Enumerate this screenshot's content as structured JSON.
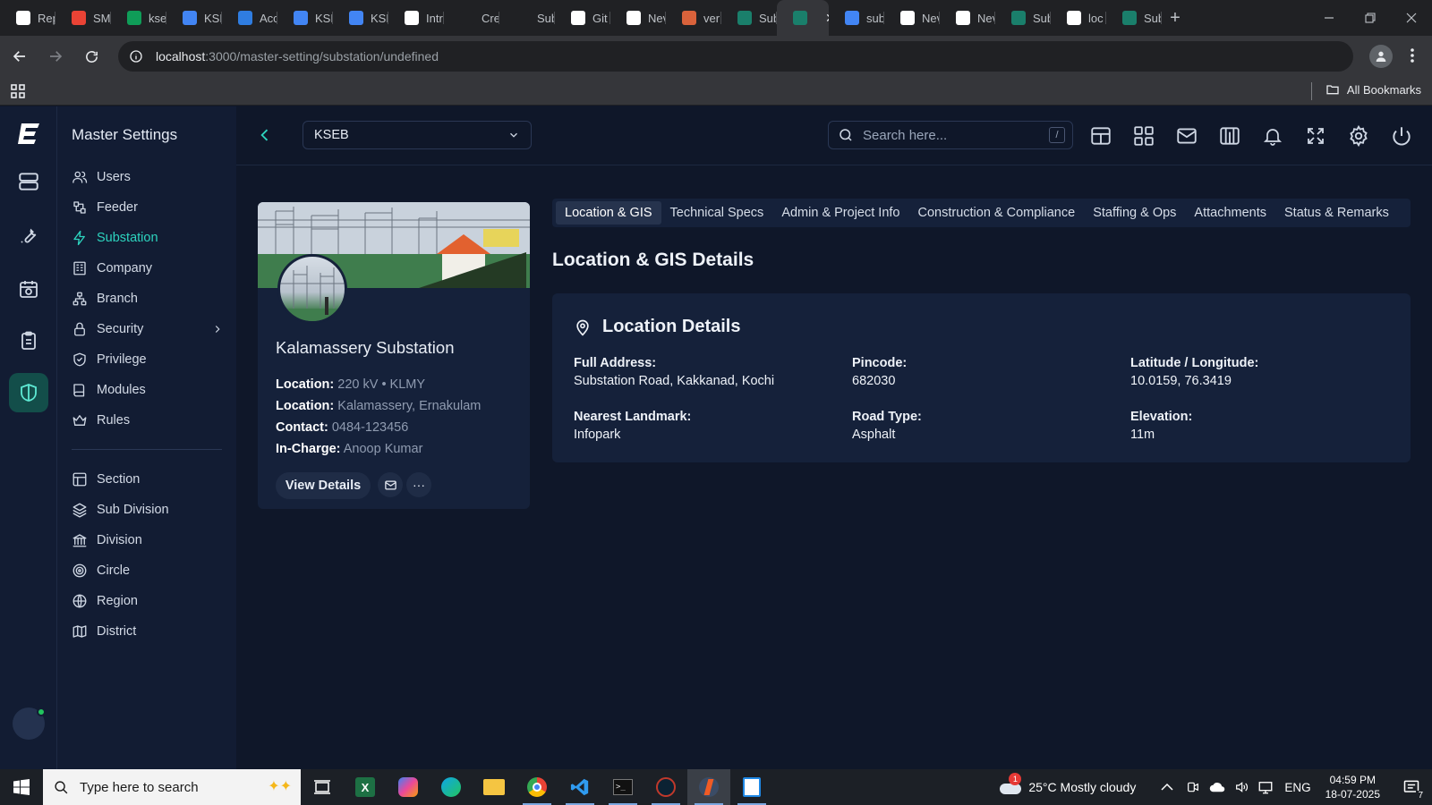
{
  "browser": {
    "tabs": [
      {
        "title": "Rep",
        "favicon": "report-icon",
        "color": "#ffffff"
      },
      {
        "title": "SM",
        "favicon": "gmail-icon",
        "color": "#ea4335"
      },
      {
        "title": "ksel",
        "favicon": "sheets-icon",
        "color": "#0f9d58"
      },
      {
        "title": "KSE",
        "favicon": "docs-icon",
        "color": "#4285f4"
      },
      {
        "title": "Acc",
        "favicon": "azure-icon",
        "color": "#2f7de1"
      },
      {
        "title": "KSE",
        "favicon": "docs-icon",
        "color": "#4285f4"
      },
      {
        "title": "KSE",
        "favicon": "docs-icon",
        "color": "#4285f4"
      },
      {
        "title": "Intr",
        "favicon": "openai-icon",
        "color": "#ffffff"
      },
      {
        "title": "Cre",
        "favicon": "blank-icon",
        "color": "#202124"
      },
      {
        "title": "Sub",
        "favicon": "blank-icon",
        "color": "#202124"
      },
      {
        "title": "Git",
        "favicon": "github-icon",
        "color": "#ffffff"
      },
      {
        "title": "Nev",
        "favicon": "chatgpt-icon",
        "color": "#ffffff"
      },
      {
        "title": "ver",
        "favicon": "vercel-icon",
        "color": "#d9623b"
      },
      {
        "title": "Sub",
        "favicon": "app-e-icon",
        "color": "#1a7f6b"
      },
      {
        "title": "",
        "favicon": "app-e-icon",
        "color": "#1a7f6b",
        "active": true,
        "close": "✕"
      },
      {
        "title": "sub",
        "favicon": "google-icon",
        "color": "#4285f4"
      },
      {
        "title": "Nev",
        "favicon": "chatgpt-icon",
        "color": "#ffffff"
      },
      {
        "title": "Nev",
        "favicon": "chatgpt-icon",
        "color": "#ffffff"
      },
      {
        "title": "Sub",
        "favicon": "app-e-icon",
        "color": "#1a7f6b"
      },
      {
        "title": "loc",
        "favicon": "vercel-triangle-icon",
        "color": "#ffffff"
      },
      {
        "title": "Sub",
        "favicon": "app-e-icon",
        "color": "#1a7f6b"
      }
    ],
    "new_tab": "+",
    "url_host": "localhost",
    "url_path": ":3000/master-setting/substation/undefined",
    "all_bookmarks": "All Bookmarks"
  },
  "sidebar": {
    "title": "Master Settings",
    "items": [
      {
        "label": "Users",
        "icon": "users-icon"
      },
      {
        "label": "Feeder",
        "icon": "feeder-icon"
      },
      {
        "label": "Substation",
        "icon": "zap-icon",
        "active": true
      },
      {
        "label": "Company",
        "icon": "building-icon"
      },
      {
        "label": "Branch",
        "icon": "branch-icon"
      },
      {
        "label": "Security",
        "icon": "lock-icon",
        "chevron": true
      },
      {
        "label": "Privilege",
        "icon": "shield-check-icon"
      },
      {
        "label": "Modules",
        "icon": "book-icon"
      },
      {
        "label": "Rules",
        "icon": "crown-icon"
      }
    ],
    "items2": [
      {
        "label": "Section",
        "icon": "grid-icon"
      },
      {
        "label": "Sub Division",
        "icon": "layers-icon"
      },
      {
        "label": "Division",
        "icon": "landmark-icon"
      },
      {
        "label": "Circle",
        "icon": "target-icon"
      },
      {
        "label": "Region",
        "icon": "globe-icon"
      },
      {
        "label": "District",
        "icon": "map-icon"
      }
    ]
  },
  "header": {
    "org_value": "KSEB",
    "search_placeholder": "Search here...",
    "search_shortcut": "/"
  },
  "profile": {
    "name": "Kalamassery Substation",
    "rows": [
      {
        "label": "Location:",
        "value": "220 kV • KLMY"
      },
      {
        "label": "Location:",
        "value": "Kalamassery, Ernakulam"
      },
      {
        "label": "Contact:",
        "value": "0484-123456"
      },
      {
        "label": "In-Charge:",
        "value": "Anoop Kumar"
      }
    ],
    "view_details": "View Details",
    "more": "···"
  },
  "tabs": [
    "Location & GIS",
    "Technical Specs",
    "Admin & Project Info",
    "Construction & Compliance",
    "Staffing & Ops",
    "Attachments",
    "Status & Remarks"
  ],
  "active_tab": "Location & GIS",
  "section_title": "Location & GIS Details",
  "details": {
    "heading": "Location Details",
    "fields": [
      {
        "label": "Full Address:",
        "value": "Substation Road, Kakkanad, Kochi"
      },
      {
        "label": "Pincode:",
        "value": "682030"
      },
      {
        "label": "Latitude / Longitude:",
        "value": "10.0159, 76.3419"
      },
      {
        "label": "Nearest Landmark:",
        "value": "Infopark"
      },
      {
        "label": "Road Type:",
        "value": "Asphalt"
      },
      {
        "label": "Elevation:",
        "value": "11m"
      }
    ]
  },
  "taskbar": {
    "search_placeholder": "Type here to search",
    "weather": "25°C  Mostly cloudy",
    "weather_badge": "1",
    "language": "ENG",
    "time": "04:59 PM",
    "date": "18-07-2025",
    "notifications": "7"
  },
  "colors": {
    "accent": "#2dd4bf",
    "bg": "#0f1729",
    "panel": "#15213a"
  }
}
